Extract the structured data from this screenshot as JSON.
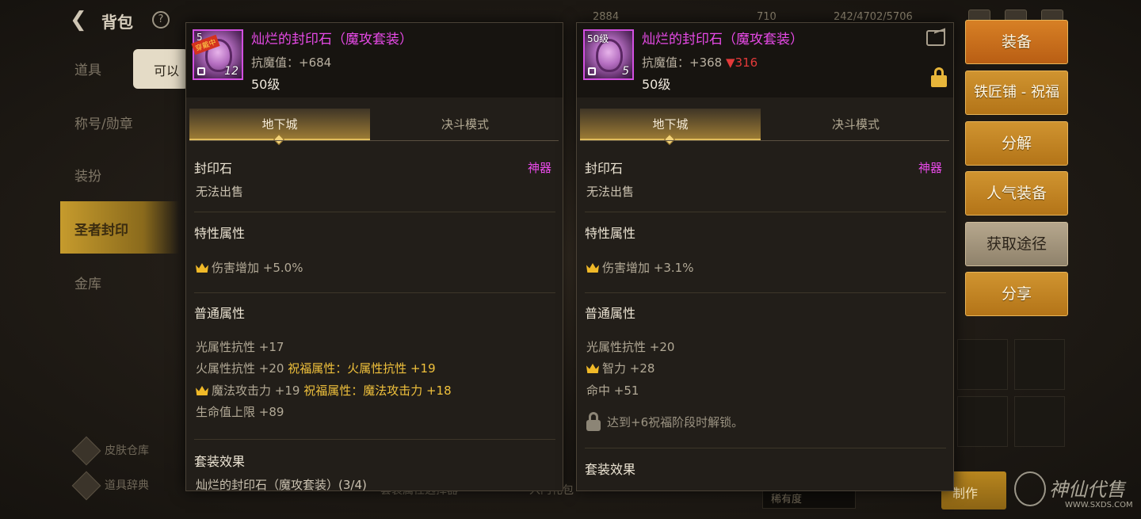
{
  "background": {
    "title": "背包",
    "tooltip_text": "可以",
    "currencies": [
      "2884",
      "710",
      "242/4702/5706"
    ],
    "side_nav": [
      "道具",
      "称号/勋章",
      "装扮",
      "圣者封印",
      "金库"
    ],
    "bottom_left": [
      "皮肤仓库",
      "道具辞典"
    ],
    "under_labels": [
      "套装属性选择器",
      "入门礼包"
    ],
    "dropdown_text": "稀有度",
    "craft_label": "制作",
    "watermark": {
      "text": "神仙代售",
      "url": "WWW.SXDS.COM"
    }
  },
  "panels": [
    {
      "icon": {
        "level": "5",
        "count": "12",
        "equipped_tag": "穿戴中"
      },
      "name": "灿烂的封印石（魔攻套装）",
      "stat_line": "抗魔值：+684",
      "stat_diff": "",
      "level": "50级",
      "tabs": [
        "地下城",
        "决斗模式"
      ],
      "type": "封印石",
      "rarity": "神器",
      "tradable": "无法出售",
      "trait_title": "特性属性",
      "trait": "伤害增加 +5.0%",
      "normal_title": "普通属性",
      "normal_lines": [
        {
          "text": "光属性抗性 +17",
          "bless": ""
        },
        {
          "text": "火属性抗性 +20",
          "bless": "祝福属性：火属性抗性 +19"
        },
        {
          "text": "魔法攻击力 +19",
          "bless": "祝福属性：魔法攻击力 +18"
        },
        {
          "text": "生命值上限 +89",
          "bless": ""
        }
      ],
      "set_title": "套装效果",
      "set_line": "灿烂的封印石（魔攻套装）(3/4)"
    },
    {
      "icon": {
        "level": "50级",
        "count": "5"
      },
      "name": "灿烂的封印石（魔攻套装）",
      "stat_line": "抗魔值：+368",
      "stat_diff": "▼316",
      "level": "50级",
      "tabs": [
        "地下城",
        "决斗模式"
      ],
      "type": "封印石",
      "rarity": "神器",
      "tradable": "无法出售",
      "trait_title": "特性属性",
      "trait": "伤害增加 +3.1%",
      "normal_title": "普通属性",
      "normal_lines": [
        {
          "text": "光属性抗性 +20"
        },
        {
          "text": "智力 +28"
        },
        {
          "text": "命中 +51"
        }
      ],
      "lock_hint": "达到+6祝福阶段时解锁。",
      "set_title": "套装效果"
    }
  ],
  "actions": [
    "装备",
    "铁匠铺 - 祝福",
    "分解",
    "人气装备",
    "获取途径",
    "分享"
  ]
}
